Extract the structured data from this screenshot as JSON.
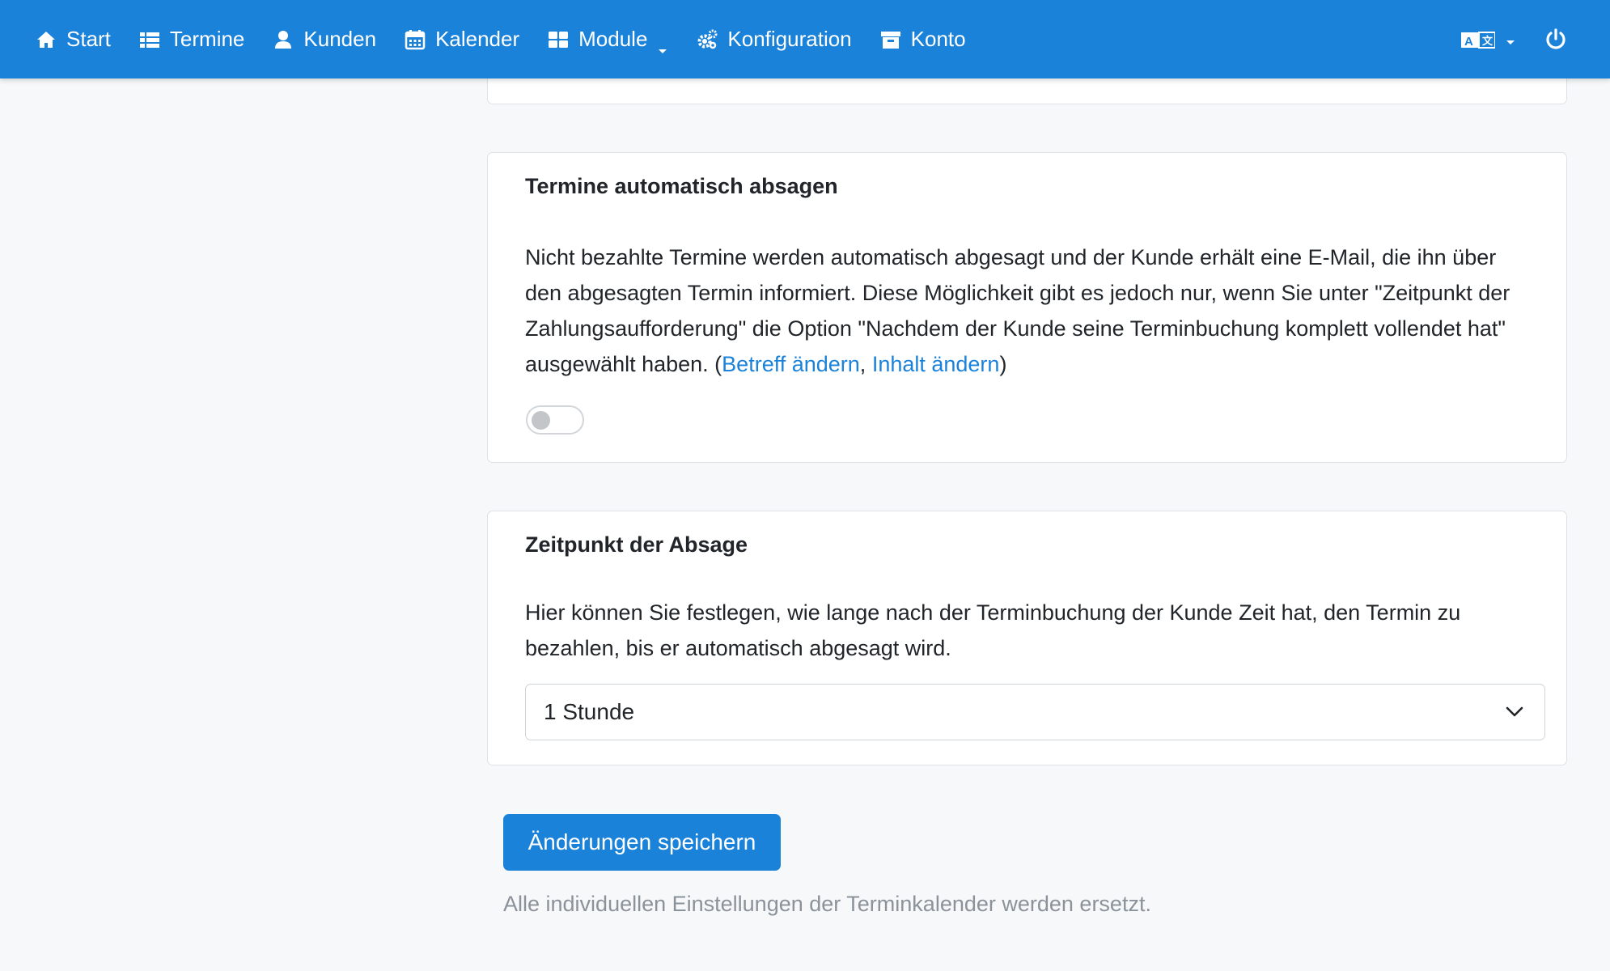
{
  "nav": {
    "items": [
      {
        "label": "Start",
        "icon": "home-icon"
      },
      {
        "label": "Termine",
        "icon": "list-icon"
      },
      {
        "label": "Kunden",
        "icon": "user-icon"
      },
      {
        "label": "Kalender",
        "icon": "calendar-icon"
      },
      {
        "label": "Module",
        "icon": "grid-icon",
        "dropdown": true
      },
      {
        "label": "Konfiguration",
        "icon": "gears-icon"
      },
      {
        "label": "Konto",
        "icon": "archive-icon"
      }
    ],
    "right": {
      "language_icon": "language-icon",
      "logout_icon": "power-icon"
    },
    "colors": {
      "background": "#1b82d9",
      "text": "#ffffff"
    }
  },
  "auto_cancel": {
    "title": "Termine automatisch absagen",
    "description": "Nicht bezahlte Termine werden automatisch abgesagt und der Kunde erhält eine E-Mail, die ihn über den abgesagten Termin informiert. Diese Möglichkeit gibt es jedoch nur, wenn Sie unter \"Zeitpunkt der Zahlungsaufforderung\" die Option \"Nachdem der Kunde seine Terminbuchung komplett vollendet hat\" ausgewählt haben. (",
    "link_subject": "Betreff ändern",
    "separator": ", ",
    "link_content": "Inhalt ändern",
    "closing": ")",
    "toggle_on": false
  },
  "cancel_time": {
    "title": "Zeitpunkt der Absage",
    "description": "Hier können Sie festlegen, wie lange nach der Terminbuchung der Kunde Zeit hat, den Termin zu bezahlen, bis er automatisch abgesagt wird.",
    "selected": "1 Stunde"
  },
  "save_button": "Änderungen speichern",
  "note": "Alle individuellen Einstellungen der Terminkalender werden ersetzt.",
  "colors": {
    "accent": "#1b82d9",
    "page_bg": "#f6f8fa",
    "muted_text": "#8b929a"
  }
}
